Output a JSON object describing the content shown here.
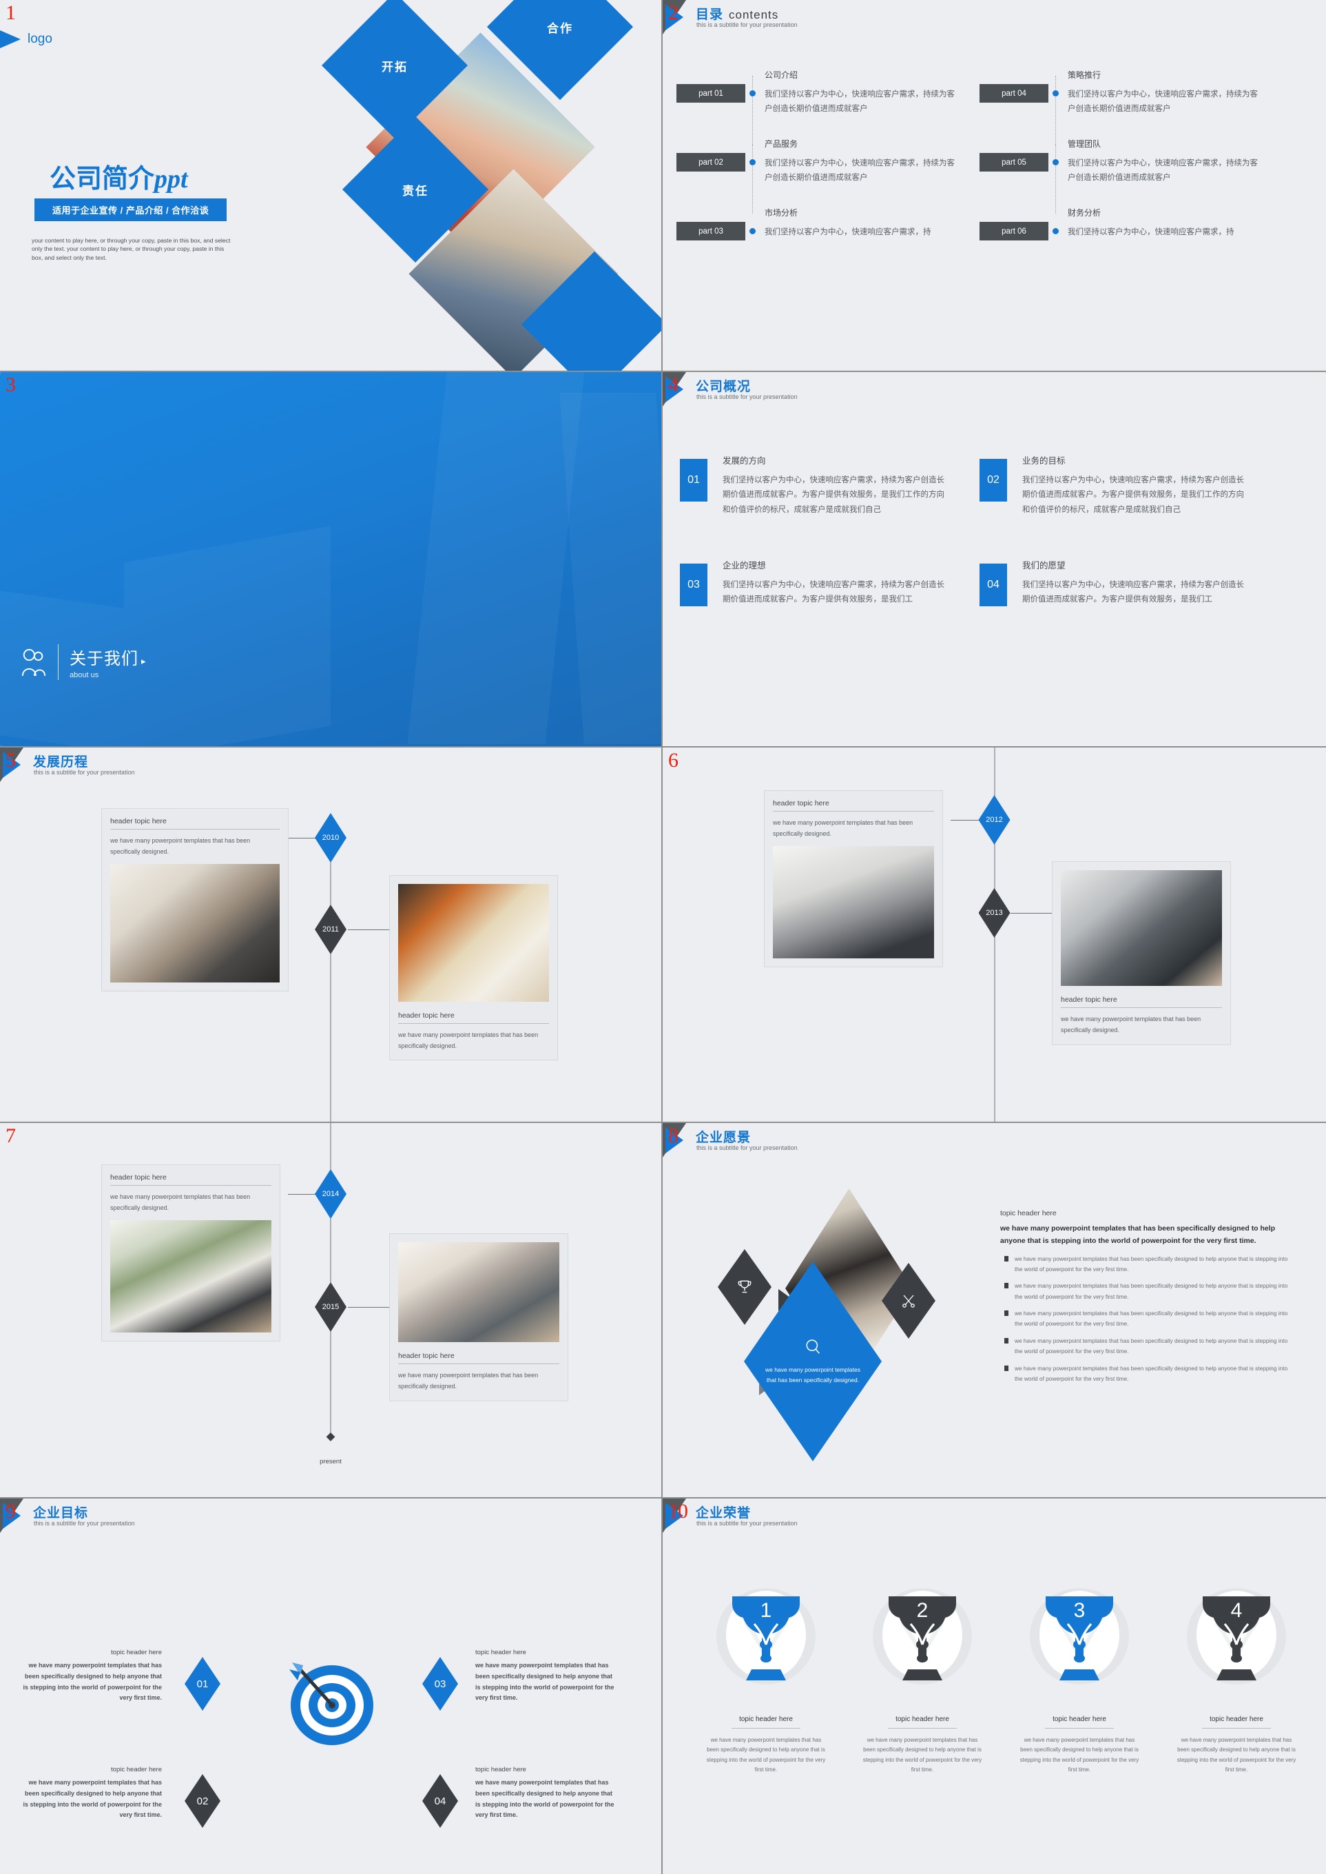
{
  "theme": {
    "blue": "#1477d1",
    "dark": "#3b3f43",
    "bg": "#eceef1",
    "red": "#ee2211"
  },
  "slides": [
    {
      "num": "1",
      "logo": "logo",
      "title_cn": "公司简介",
      "title_en": "ppt",
      "banner": "适用于企业宣传 / 产品介绍 / 合作洽谈",
      "desc": "your content to play here, or through your copy, paste in this box, and select only the text. your content to play here, or through your copy, paste in this box, and select only the text.",
      "diamonds": [
        "开拓",
        "合作",
        "责任"
      ]
    },
    {
      "num": "2",
      "title_cn": "目录",
      "title_en": "contents",
      "subtitle": "this is a subtitle for your presentation",
      "items": [
        {
          "tag": "part 01",
          "head": "公司介绍",
          "body": "我们坚持以客户为中心，快速响应客户需求，持续为客户创造长期价值进而成就客户"
        },
        {
          "tag": "part 02",
          "head": "产品服务",
          "body": "我们坚持以客户为中心，快速响应客户需求，持续为客户创造长期价值进而成就客户"
        },
        {
          "tag": "part 03",
          "head": "市场分析",
          "body": "我们坚持以客户为中心，快速响应客户需求，持"
        },
        {
          "tag": "part 04",
          "head": "策略推行",
          "body": "我们坚持以客户为中心，快速响应客户需求，持续为客户创造长期价值进而成就客户"
        },
        {
          "tag": "part 05",
          "head": "管理团队",
          "body": "我们坚持以客户为中心，快速响应客户需求，持续为客户创造长期价值进而成就客户"
        },
        {
          "tag": "part 06",
          "head": "财务分析",
          "body": "我们坚持以客户为中心，快速响应客户需求，持"
        }
      ]
    },
    {
      "num": "3",
      "footer_cn": "关于我们",
      "footer_arrow": "▸",
      "footer_en": "about us"
    },
    {
      "num": "4",
      "title_cn": "公司概况",
      "subtitle": "this is a subtitle for your presentation",
      "items": [
        {
          "num": "01",
          "head": "发展的方向",
          "body": "我们坚持以客户为中心，快速响应客户需求，持续为客户创造长期价值进而成就客户。为客户提供有效服务，是我们工作的方向和价值评价的标尺，成就客户是成就我们自己"
        },
        {
          "num": "02",
          "head": "业务的目标",
          "body": "我们坚持以客户为中心，快速响应客户需求，持续为客户创造长期价值进而成就客户。为客户提供有效服务，是我们工作的方向和价值评价的标尺，成就客户是成就我们自己"
        },
        {
          "num": "03",
          "head": "企业的理想",
          "body": "我们坚持以客户为中心，快速响应客户需求，持续为客户创造长期价值进而成就客户。为客户提供有效服务，是我们工"
        },
        {
          "num": "04",
          "head": "我们的愿望",
          "body": "我们坚持以客户为中心，快速响应客户需求，持续为客户创造长期价值进而成就客户。为客户提供有效服务，是我们工"
        }
      ]
    },
    {
      "num": "5",
      "title_cn": "发展历程",
      "subtitle": "this is a subtitle for your presentation",
      "markers": [
        {
          "year": "2010",
          "style": "blue",
          "side": "left"
        },
        {
          "year": "2011",
          "style": "dark",
          "side": "right"
        }
      ],
      "cards": [
        {
          "head": "header topic here",
          "body": "we have many powerpoint templates that has been specifically designed."
        },
        {
          "head": "header topic here",
          "body": "we have many powerpoint templates that has been specifically designed."
        }
      ]
    },
    {
      "num": "6",
      "markers": [
        {
          "year": "2012",
          "style": "blue",
          "side": "left"
        },
        {
          "year": "2013",
          "style": "dark",
          "side": "right"
        }
      ],
      "cards": [
        {
          "head": "header topic here",
          "body": "we have many powerpoint templates that has been specifically designed."
        },
        {
          "head": "header topic here",
          "body": "we have many powerpoint templates that has been specifically designed."
        }
      ]
    },
    {
      "num": "7",
      "markers": [
        {
          "year": "2014",
          "style": "blue",
          "side": "left"
        },
        {
          "year": "2015",
          "style": "dark",
          "side": "right"
        }
      ],
      "cards": [
        {
          "head": "header topic here",
          "body": "we have many powerpoint templates that has been specifically designed."
        },
        {
          "head": "header topic here",
          "body": "we have many powerpoint templates that has been specifically designed."
        }
      ],
      "end_label": "present"
    },
    {
      "num": "8",
      "title_cn": "企业愿景",
      "subtitle": "this is a subtitle for your presentation",
      "diamond_caption": "we have many powerpoint templates that has been specifically designed.",
      "topic_head": "topic header here",
      "topic_lead": "we have many powerpoint templates that has been specifically designed to help anyone that is stepping into the world of powerpoint for the very first time.",
      "bullets": [
        "we have many powerpoint templates that has been specifically designed to help anyone that is stepping into the world of powerpoint for the very first time.",
        "we have many powerpoint templates that has been specifically designed to help anyone that is stepping into the world of powerpoint for the very first time.",
        "we have many powerpoint templates that has been specifically designed to help anyone that is stepping into the world of powerpoint for the very first time.",
        "we have many powerpoint templates that has been specifically designed to help anyone that is stepping into the world of powerpoint for the very first time.",
        "we have many powerpoint templates that has been specifically designed to help anyone that is stepping into the world of powerpoint for the very first time."
      ]
    },
    {
      "num": "9",
      "title_cn": "企业目标",
      "subtitle": "this is a subtitle for your presentation",
      "items": [
        {
          "num": "01",
          "style": "blue",
          "head": "topic header here",
          "body": "we have many powerpoint templates that has been specifically designed to help anyone that is stepping into the world of powerpoint for the very first time."
        },
        {
          "num": "02",
          "style": "dark",
          "head": "topic header here",
          "body": "we have many powerpoint templates that has been specifically designed to help anyone that is stepping into the world of powerpoint for the very first time."
        },
        {
          "num": "03",
          "style": "blue",
          "head": "topic header here",
          "body": "we have many powerpoint templates that has been specifically designed to help anyone that is stepping into the world of powerpoint for the very first time."
        },
        {
          "num": "04",
          "style": "dark",
          "head": "topic header here",
          "body": "we have many powerpoint templates that has been specifically designed to help anyone that is stepping into the world of powerpoint for the very first time."
        }
      ]
    },
    {
      "num": "10",
      "title_cn": "企业荣誉",
      "subtitle": "this is a subtitle for your presentation",
      "items": [
        {
          "rank": "1",
          "style": "blue",
          "head": "topic header here",
          "body": "we have many powerpoint templates that has been specifically designed to help anyone that is stepping into the world of powerpoint for the very first time."
        },
        {
          "rank": "2",
          "style": "dark",
          "head": "topic header here",
          "body": "we have many powerpoint templates that has been specifically designed to help anyone that is stepping into the world of powerpoint for the very first time."
        },
        {
          "rank": "3",
          "style": "blue",
          "head": "topic header here",
          "body": "we have many powerpoint templates that has been specifically designed to help anyone that is stepping into the world of powerpoint for the very first time."
        },
        {
          "rank": "4",
          "style": "dark",
          "head": "topic header here",
          "body": "we have many powerpoint templates that has been specifically designed to help anyone that is stepping into the world of powerpoint for the very first time."
        }
      ]
    }
  ]
}
